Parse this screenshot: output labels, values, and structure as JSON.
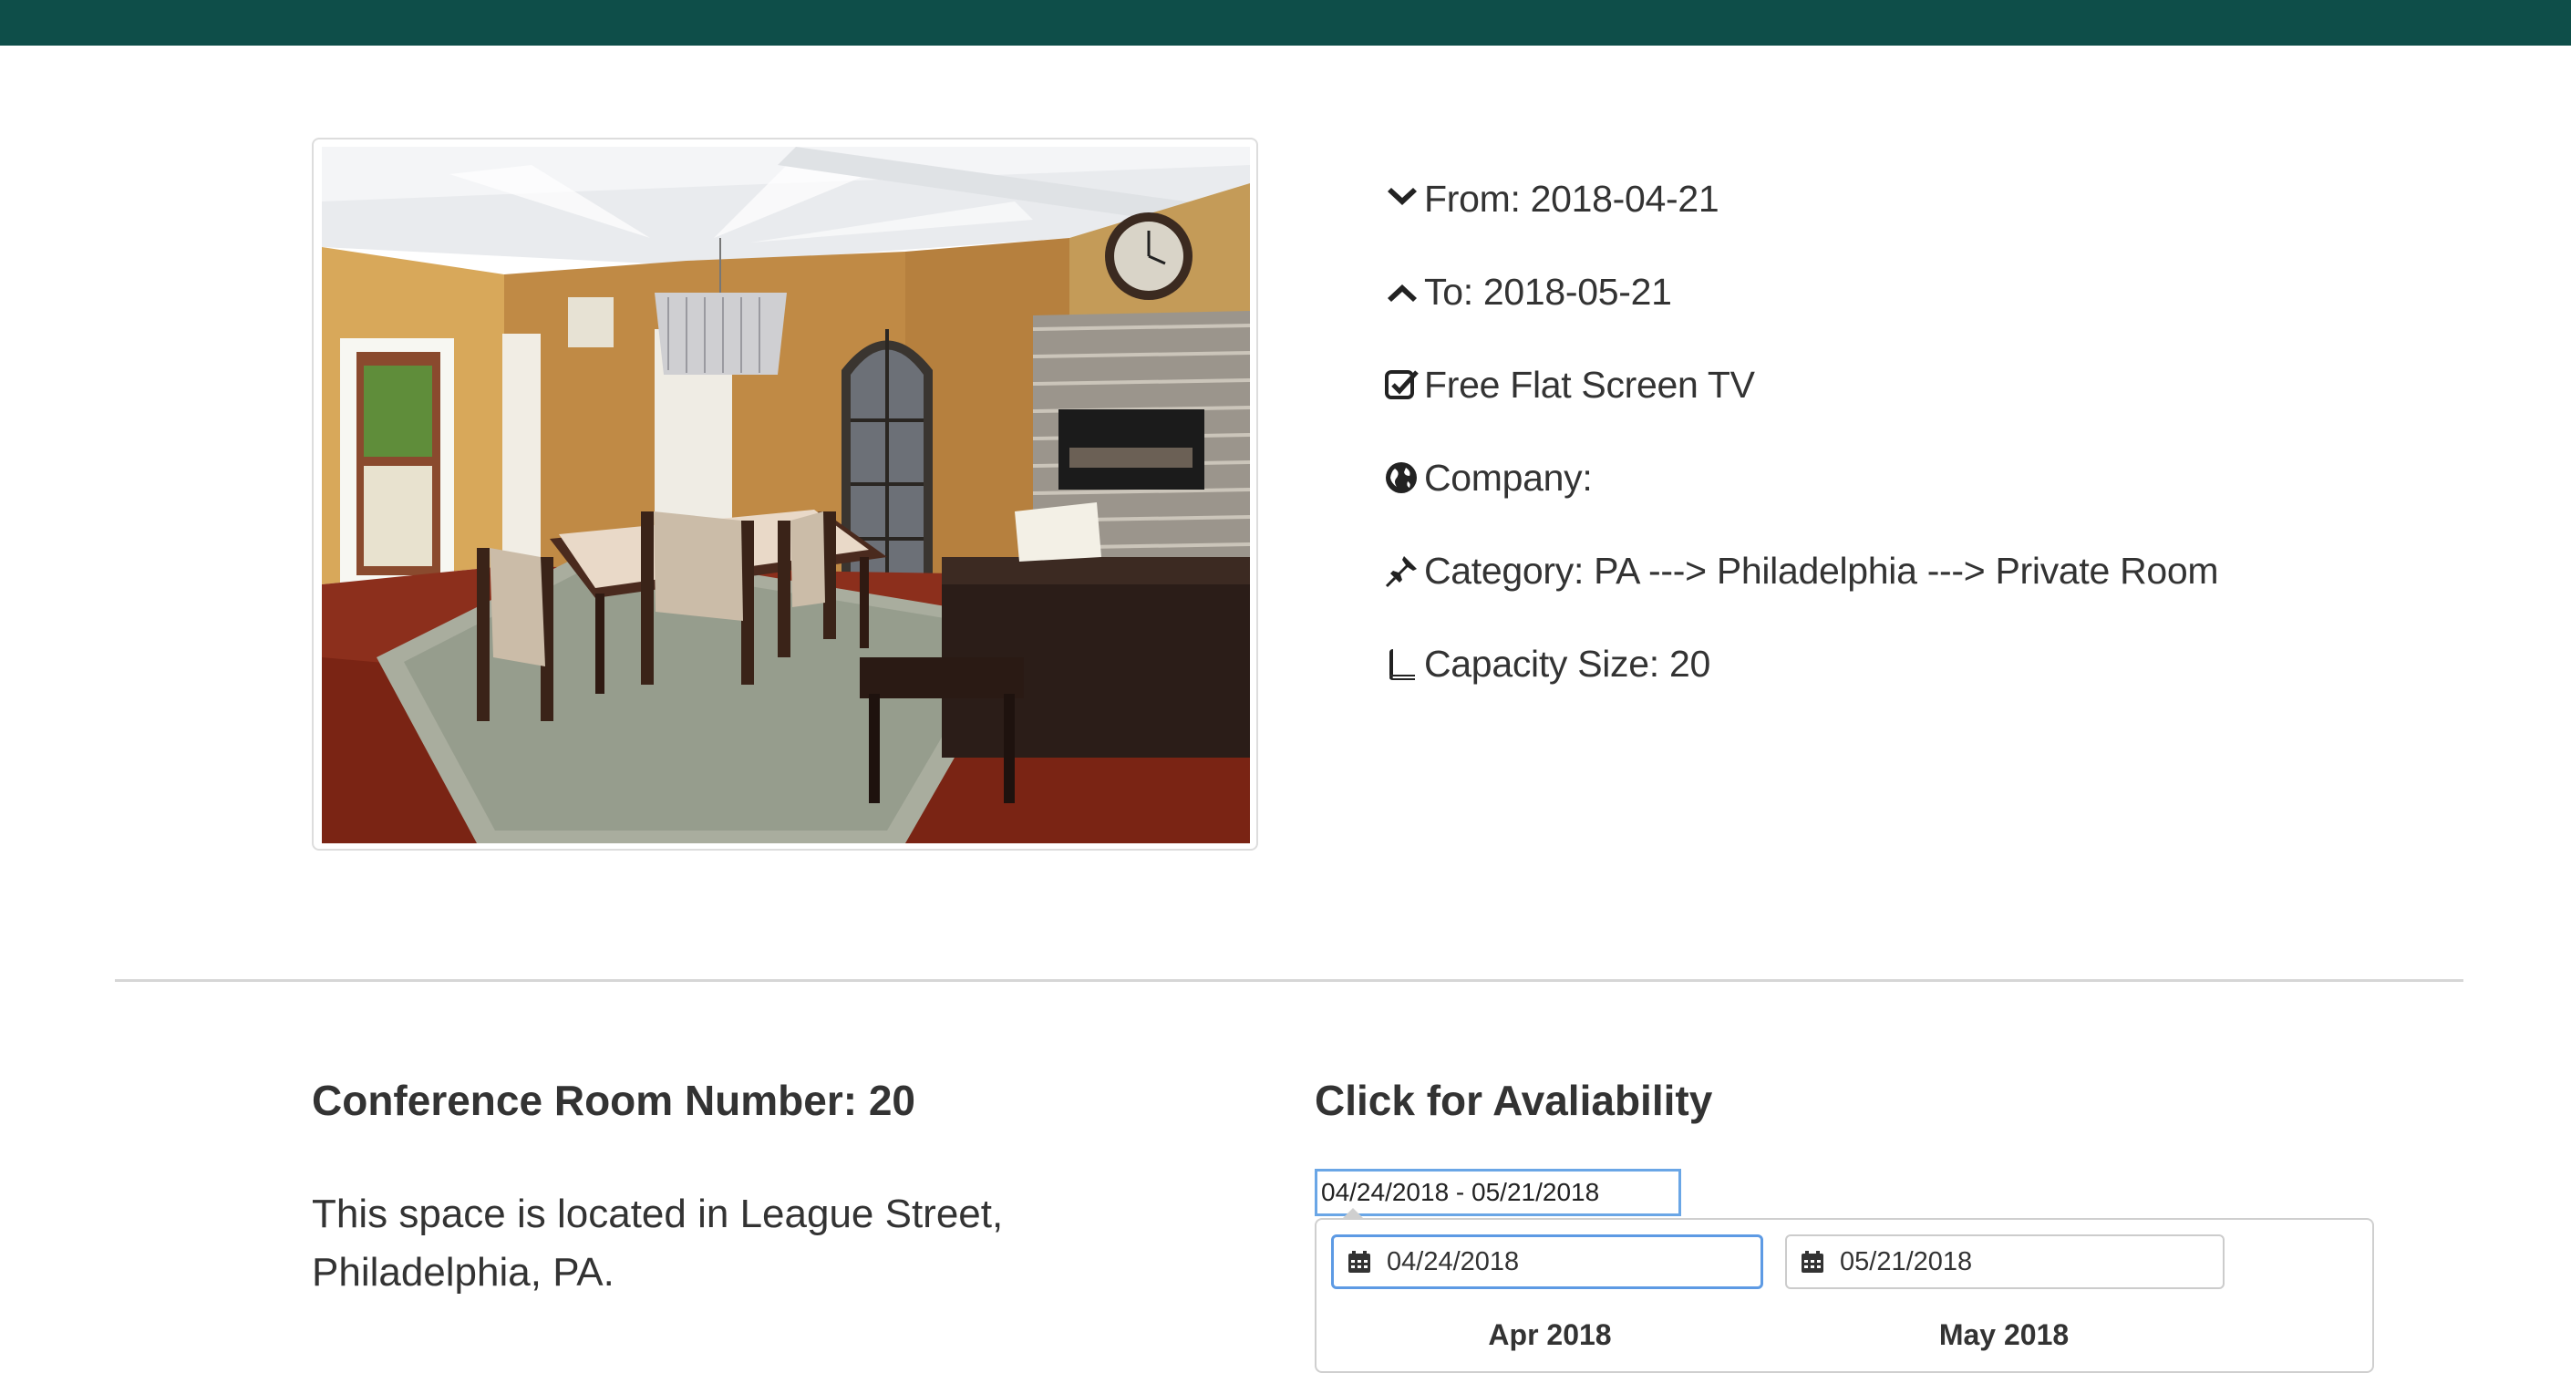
{
  "listing": {
    "photo_alt": "Dining room with chandelier, table and piano",
    "details": [
      {
        "icon": "chevron-down-icon",
        "text": "From: 2018-04-21"
      },
      {
        "icon": "chevron-up-icon",
        "text": "To: 2018-05-21"
      },
      {
        "icon": "checkbox-icon",
        "text": "Free Flat Screen TV"
      },
      {
        "icon": "globe-icon",
        "text": "Company:"
      },
      {
        "icon": "pushpin-icon",
        "text": "Category: PA ---> Philadelphia ---> Private Room"
      },
      {
        "icon": "book-icon",
        "text": "Capacity Size: 20"
      }
    ]
  },
  "room": {
    "title": "Conference Room Number: 20",
    "description": "This space is located in League Street, Philadelphia, PA."
  },
  "availability": {
    "title": "Click for Avaliability",
    "range_value": "04/24/2018 - 05/21/2018",
    "start_date": "04/24/2018",
    "end_date": "05/21/2018",
    "months": [
      "Apr 2018",
      "May 2018"
    ],
    "icon": "calendar-icon"
  },
  "colors": {
    "topbar": "#0e4e49",
    "focus": "#5d9ae4"
  }
}
